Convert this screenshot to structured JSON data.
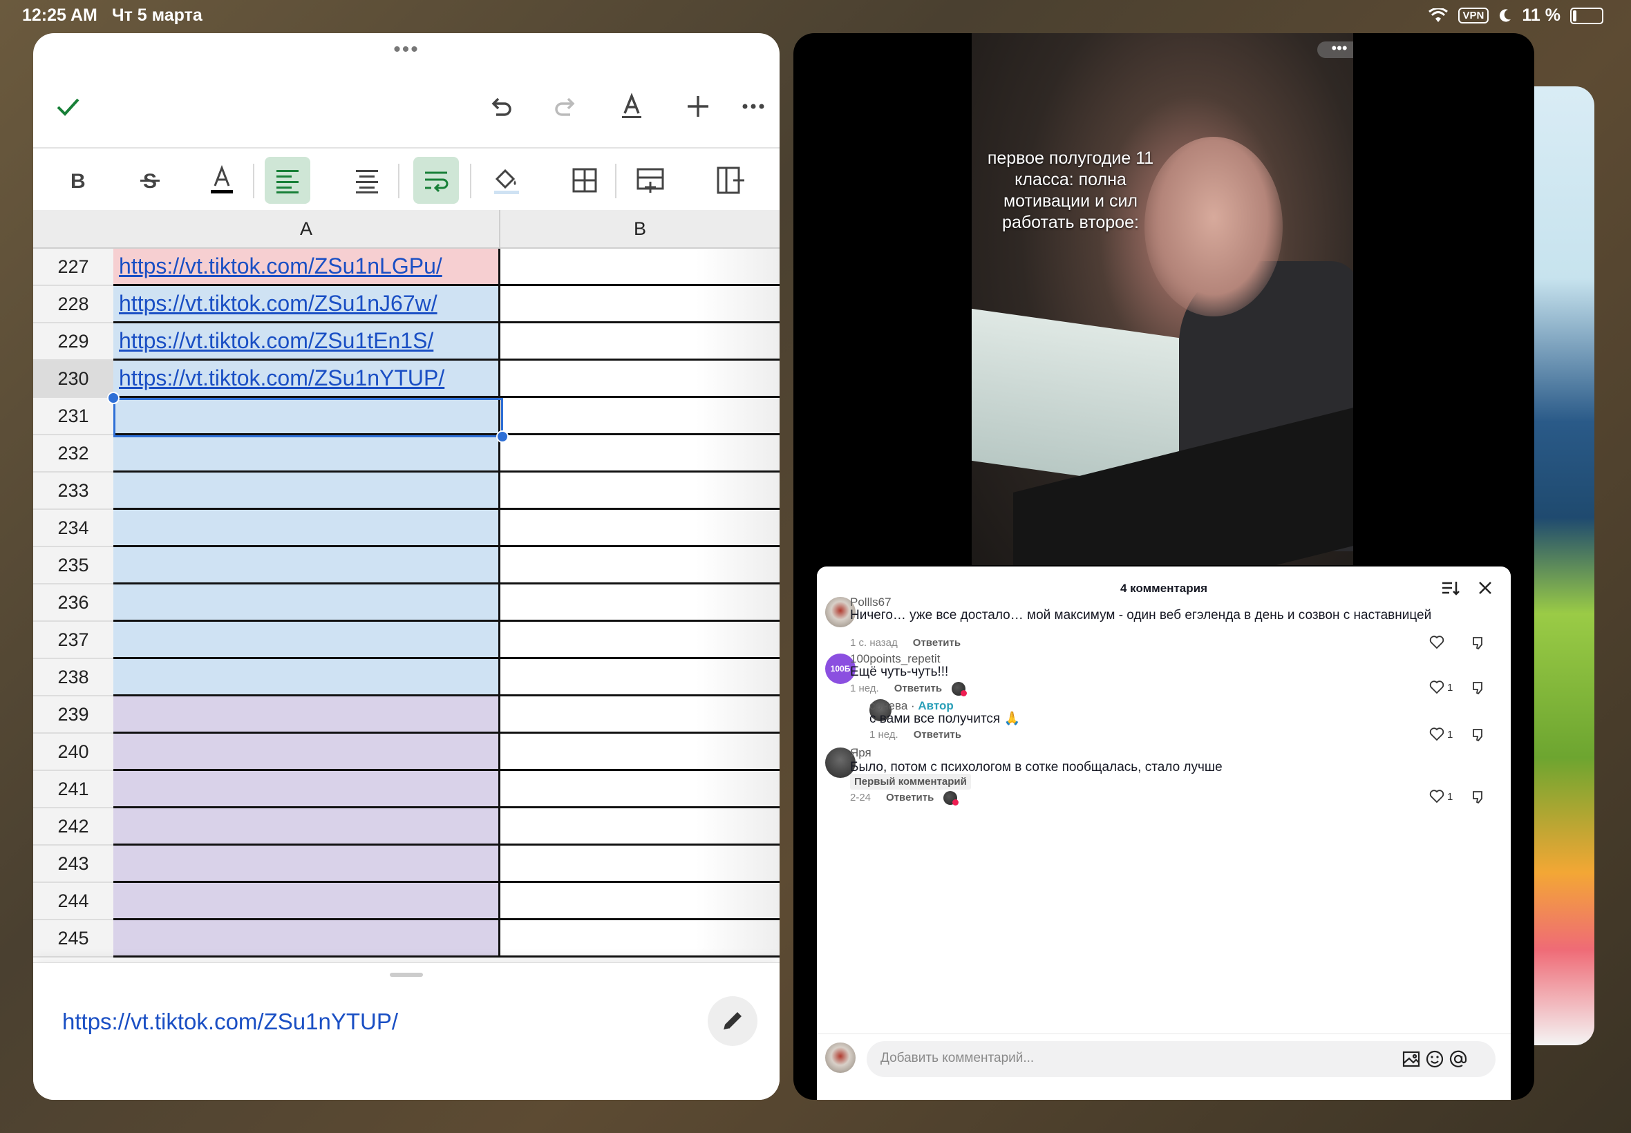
{
  "status_bar": {
    "time": "12:25 AM",
    "date": "Чт 5 марта",
    "vpn": "VPN",
    "battery": "11 %"
  },
  "sheets": {
    "multitask_dots": "•••",
    "columns": [
      "A",
      "B"
    ],
    "rows": [
      {
        "num": "227",
        "a": "https://vt.tiktok.com/ZSu1nLGPu/",
        "color": "#f6cfd1"
      },
      {
        "num": "228",
        "a": "https://vt.tiktok.com/ZSu1nJ67w/",
        "color": "#cfe2f3"
      },
      {
        "num": "229",
        "a": "https://vt.tiktok.com/ZSu1tEn1S/",
        "color": "#cfe2f3"
      },
      {
        "num": "230",
        "a": "https://vt.tiktok.com/ZSu1nYTUP/",
        "color": "#cfe2f3"
      },
      {
        "num": "231",
        "a": "",
        "color": "#cfe2f3"
      },
      {
        "num": "232",
        "a": "",
        "color": "#cfe2f3"
      },
      {
        "num": "233",
        "a": "",
        "color": "#cfe2f3"
      },
      {
        "num": "234",
        "a": "",
        "color": "#cfe2f3"
      },
      {
        "num": "235",
        "a": "",
        "color": "#cfe2f3"
      },
      {
        "num": "236",
        "a": "",
        "color": "#cfe2f3"
      },
      {
        "num": "237",
        "a": "",
        "color": "#cfe2f3"
      },
      {
        "num": "238",
        "a": "",
        "color": "#cfe2f3"
      },
      {
        "num": "239",
        "a": "",
        "color": "#d9d2e9"
      },
      {
        "num": "240",
        "a": "",
        "color": "#d9d2e9"
      },
      {
        "num": "241",
        "a": "",
        "color": "#d9d2e9"
      },
      {
        "num": "242",
        "a": "",
        "color": "#d9d2e9"
      },
      {
        "num": "243",
        "a": "",
        "color": "#d9d2e9"
      },
      {
        "num": "244",
        "a": "",
        "color": "#d9d2e9"
      },
      {
        "num": "245",
        "a": "",
        "color": "#d9d2e9"
      }
    ],
    "selected_row": "230",
    "edit_value": "https://vt.tiktok.com/ZSu1nYTUP/",
    "accent": "#188038",
    "selection_color": "#2e6fd6"
  },
  "tiktok": {
    "caption": "первое полугодие 11 класса: полна мотивации и сил работать второе:",
    "grab_dots": "•••",
    "comments_title": "4 комментария",
    "comments": [
      {
        "user": "Pollls67",
        "text": "Ничего… уже все достало… мой максимум - один веб егэленда в день и созвон с наставницей",
        "time": "1 с. назад",
        "reply": "Ответить",
        "likes": ""
      },
      {
        "user": "100points_repetit",
        "avatar_text": "100Б",
        "text": "Ещё чуть-чуть!!!",
        "time": "1 нед.",
        "reply": "Ответить",
        "likes": "1"
      },
      {
        "user": "сонева",
        "author_sep": " · ",
        "author_label": "Автор",
        "text": "с вами все получится 🙏",
        "time": "1 нед.",
        "reply": "Ответить",
        "likes": "1"
      },
      {
        "user": "Яря",
        "text": "Было, потом с психологом в сотке пообщалась, стало лучше",
        "badge": "Первый комментарий",
        "time": "2-24",
        "reply": "Ответить",
        "likes": "1"
      }
    ],
    "input_placeholder": "Добавить комментарий..."
  }
}
